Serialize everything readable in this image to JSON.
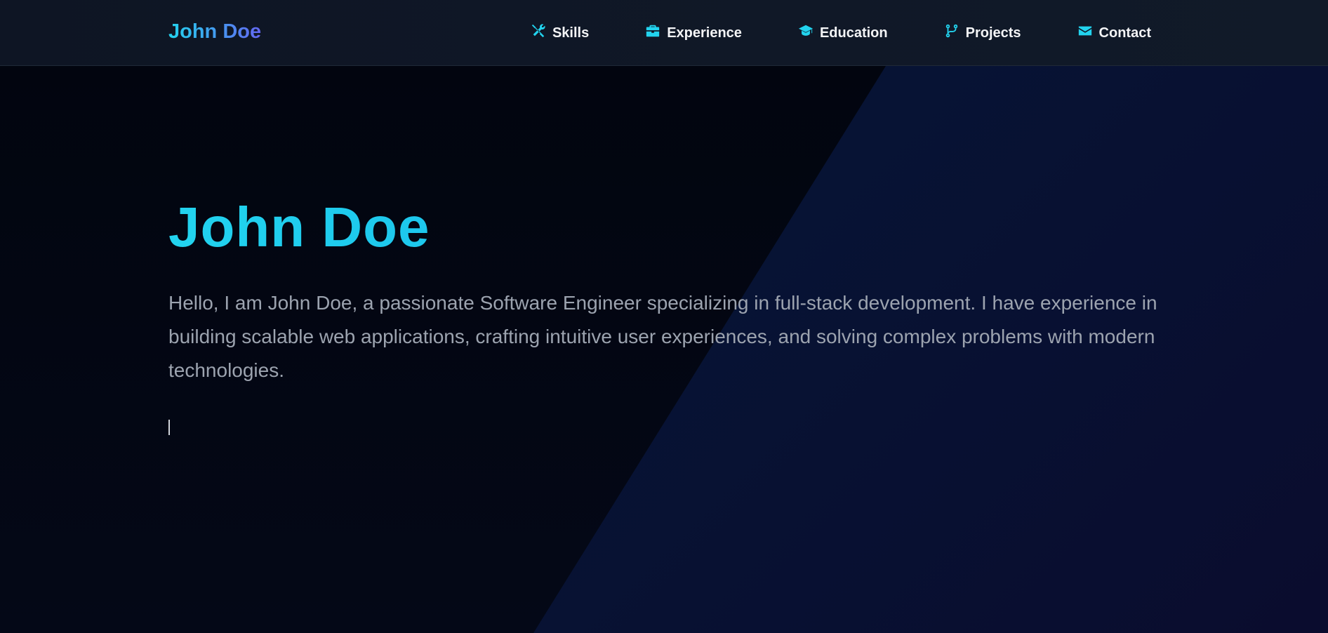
{
  "header": {
    "logo": "John Doe",
    "nav": [
      {
        "label": "Skills",
        "icon": "tools-icon"
      },
      {
        "label": "Experience",
        "icon": "briefcase-icon"
      },
      {
        "label": "Education",
        "icon": "graduation-cap-icon"
      },
      {
        "label": "Projects",
        "icon": "git-branch-icon"
      },
      {
        "label": "Contact",
        "icon": "envelope-icon"
      }
    ]
  },
  "hero": {
    "title": "John Doe",
    "description": "Hello, I am John Doe, a passionate Software Engineer specializing in full-stack development. I have experience in building scalable web applications, crafting intuitive user experiences, and solving complex problems with modern technologies."
  },
  "colors": {
    "accent": "#22d3ee",
    "logo_gradient_end": "#6366f1",
    "background": "#03060f",
    "header_bg": "#111a29"
  }
}
